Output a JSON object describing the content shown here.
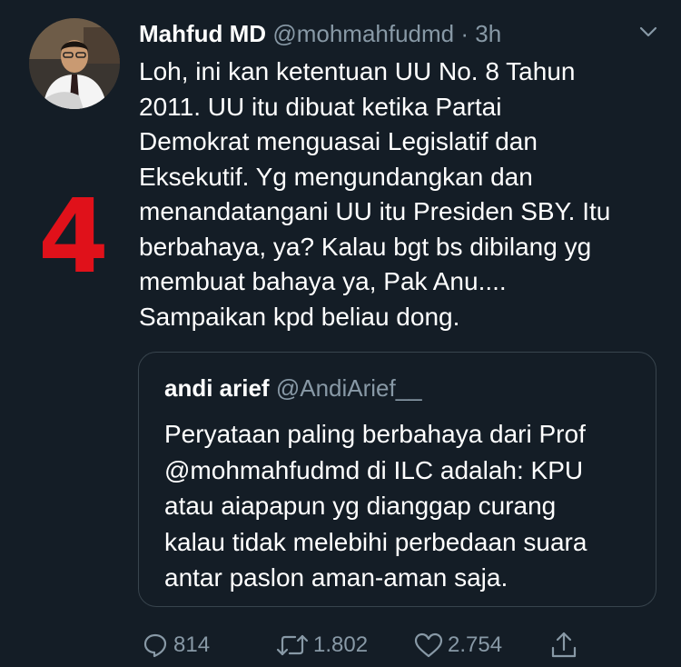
{
  "tweet": {
    "author_name": "Mahfud MD",
    "handle": "@mohmahfudmd",
    "separator": "·",
    "time": "3h",
    "overlay_number": "4",
    "text_lines": [
      "Loh, ini kan ketentuan UU No. 8 Tahun",
      "2011. UU itu dibuat ketika Partai",
      "Demokrat menguasai Legislatif dan",
      "Eksekutif. Yg mengundangkan dan",
      "menandatangani UU itu Presiden SBY. Itu",
      "berbahaya, ya? Kalau bgt bs dibilang yg",
      "membuat bahaya ya, Pak Anu....",
      "Sampaikan kpd beliau dong."
    ]
  },
  "quote": {
    "author_name": "andi arief",
    "handle": "@AndiArief__",
    "text_lines": [
      "Peryataan paling berbahaya dari Prof",
      "@mohmahfudmd di ILC adalah: KPU",
      "atau aiapapun yg dianggap curang",
      "kalau tidak melebihi perbedaan suara",
      "antar paslon aman-aman saja."
    ]
  },
  "actions": {
    "reply_count": "814",
    "retweet_count": "1.802",
    "like_count": "2.754"
  },
  "icons": {
    "reply": "reply-icon",
    "retweet": "retweet-icon",
    "like": "heart-icon",
    "share": "share-icon",
    "caret": "chevron-down-icon"
  },
  "colors": {
    "background": "#141d26",
    "text": "#ffffff",
    "muted": "#8899a6",
    "border": "#38444d",
    "overlay_number": "#e0111a"
  }
}
